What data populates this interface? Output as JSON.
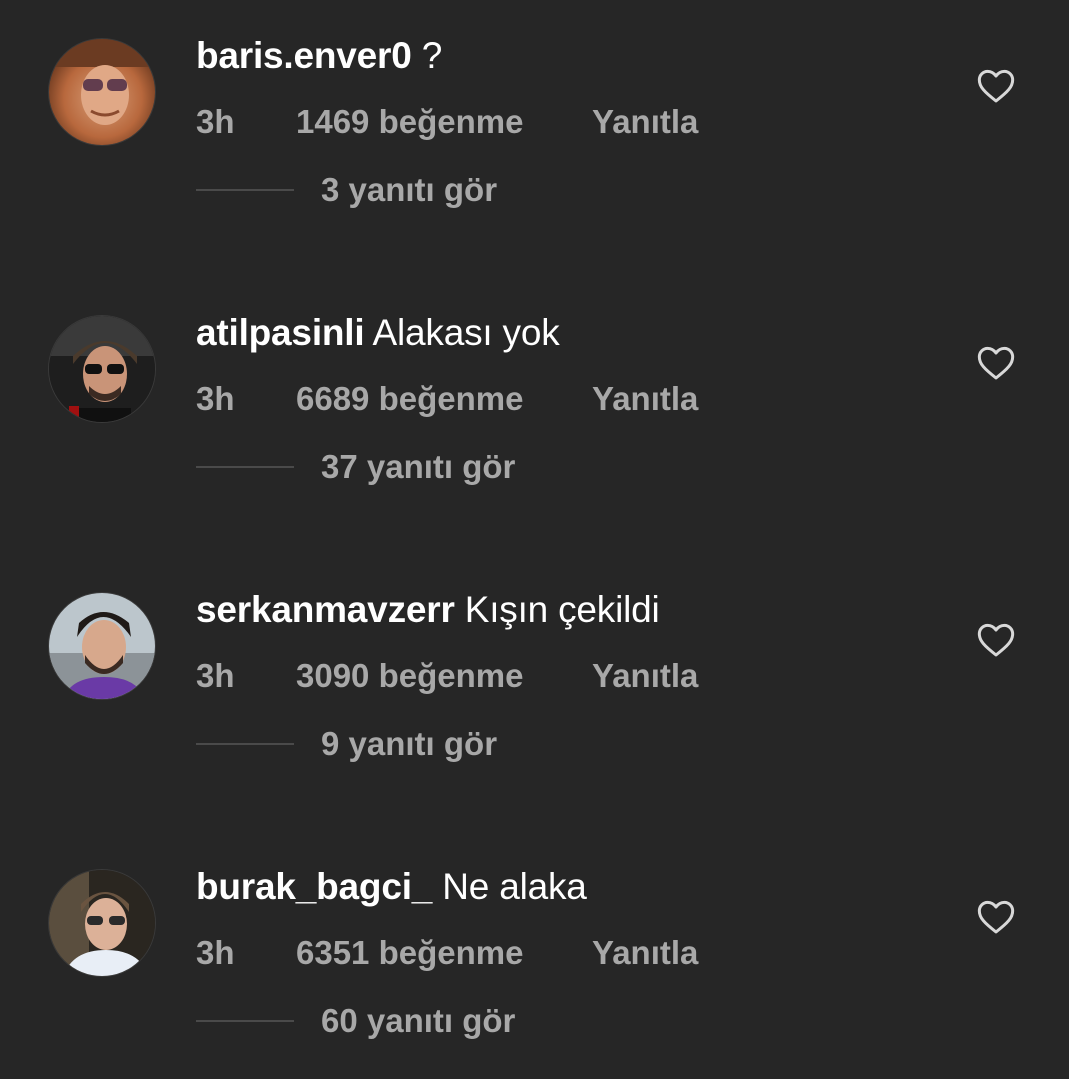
{
  "comments": [
    {
      "username": "baris.enver0",
      "text": "?",
      "time": "3h",
      "likes": "1469 beğenme",
      "reply": "Yanıtla",
      "view_replies": "3 yanıtı gör",
      "avatar_icon": "avatar-baris-enver0"
    },
    {
      "username": "atilpasinli",
      "text": "Alakası yok",
      "time": "3h",
      "likes": "6689 beğenme",
      "reply": "Yanıtla",
      "view_replies": "37 yanıtı gör",
      "avatar_icon": "avatar-atilpasinli"
    },
    {
      "username": "serkanmavzerr",
      "text": "Kışın çekildi",
      "time": "3h",
      "likes": "3090 beğenme",
      "reply": "Yanıtla",
      "view_replies": "9 yanıtı gör",
      "avatar_icon": "avatar-serkanmavzerr"
    },
    {
      "username": "burak_bagci_",
      "text": "Ne alaka",
      "time": "3h",
      "likes": "6351 beğenme",
      "reply": "Yanıtla",
      "view_replies": "60 yanıtı gör",
      "avatar_icon": "avatar-burak-bagci"
    }
  ],
  "colors": {
    "background": "#262626",
    "primary_text": "#ffffff",
    "secondary_text": "#a8a8a8",
    "divider": "#4a4a4a",
    "heart_outline": "#d8d8d8"
  }
}
